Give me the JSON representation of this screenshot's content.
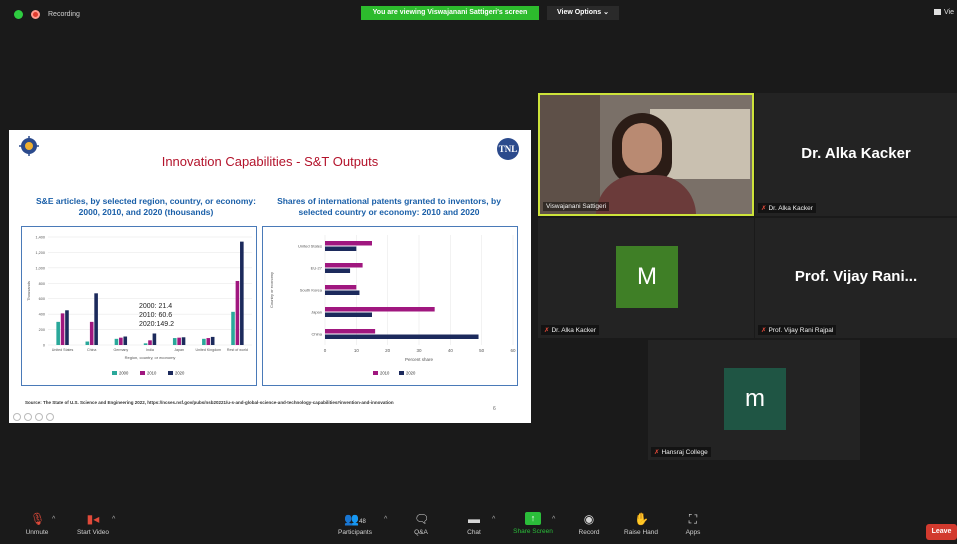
{
  "topbar": {
    "recording": "Recording",
    "viewing_banner": "You are viewing Viswajanani Sattigeri's screen",
    "view_options": "View Options",
    "view_corner": "Vie"
  },
  "slide": {
    "title": "Innovation Capabilities - S&T Outputs",
    "logo_right": "TNL",
    "left_title": "S&E articles, by selected region, country, or economy: 2000, 2010, and 2020 (thousands)",
    "right_title": "Shares of international patents granted to inventors, by selected country or economy: 2010 and 2020",
    "callout": [
      "2000: 21.4",
      "2010: 60.6",
      "2020:149.2"
    ],
    "source": "Source: The State of U.S. Science and Engineering 2022, https://ncses.nsf.gov/pubs/nsb20221/u-s-and-global-science-and-technology-capabilities#invention-and-innovation",
    "page_number": "6"
  },
  "chart_data": [
    {
      "type": "bar",
      "title": "",
      "categories": [
        "United States",
        "China",
        "Germany",
        "India",
        "Japan",
        "United Kingdom",
        "Rest of world"
      ],
      "series": [
        {
          "name": "2000",
          "color": "#2aa89a",
          "values": [
            300,
            45,
            80,
            21.4,
            90,
            80,
            430
          ]
        },
        {
          "name": "2010",
          "color": "#a0177f",
          "values": [
            410,
            300,
            95,
            60.6,
            95,
            90,
            830
          ]
        },
        {
          "name": "2020",
          "color": "#1c2a5c",
          "values": [
            450,
            670,
            110,
            149.2,
            100,
            105,
            1340
          ]
        }
      ],
      "xlabel": "Region, country, or economy",
      "ylabel": "Thousands",
      "ylim": [
        0,
        1400
      ],
      "yticks": [
        0,
        200,
        400,
        600,
        800,
        1000,
        1200,
        1400
      ],
      "ytick_labels": [
        "0",
        "200",
        "400",
        "600",
        "800",
        "1,000",
        "1,200",
        "1,400"
      ],
      "grid": true,
      "legend": "bottom"
    },
    {
      "type": "bar",
      "orientation": "horizontal",
      "title": "",
      "categories": [
        "United States",
        "EU-27",
        "South Korea",
        "Japan",
        "China"
      ],
      "series": [
        {
          "name": "2010",
          "color": "#a0177f",
          "values": [
            15,
            12,
            10,
            35,
            16
          ]
        },
        {
          "name": "2020",
          "color": "#1c2a5c",
          "values": [
            10,
            8,
            11,
            15,
            49
          ]
        }
      ],
      "xlabel": "Percent share",
      "ylabel": "Country or economy",
      "xlim": [
        0,
        60
      ],
      "xticks": [
        0,
        10,
        20,
        30,
        40,
        50,
        60
      ],
      "grid": true,
      "legend": "bottom"
    }
  ],
  "tiles": {
    "viswajanani": {
      "name": "Viswajanani Sattigeri"
    },
    "alka": {
      "display": "Dr. Alka Kacker",
      "name": "Dr. Alka Kacker"
    },
    "m": {
      "initial": "M",
      "name": "Dr. Alka Kacker",
      "color": "#3f7f26"
    },
    "vijay": {
      "display": "Prof. Vijay Rani...",
      "name": "Prof. Vijay Rani Rajpal"
    },
    "hansraj": {
      "initial": "m",
      "name": "Hansraj College",
      "color": "#1f5544"
    }
  },
  "toolbar": {
    "unmute": "Unmute",
    "start_video": "Start Video",
    "participants": "Participants",
    "participants_count": "48",
    "qa": "Q&A",
    "chat": "Chat",
    "share_screen": "Share Screen",
    "record": "Record",
    "raise_hand": "Raise Hand",
    "apps": "Apps",
    "leave": "Leave"
  }
}
